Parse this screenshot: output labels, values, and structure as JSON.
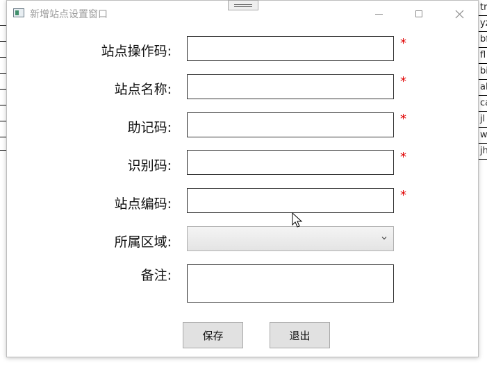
{
  "background_list": {
    "items": [
      "tr",
      "yz",
      "bf",
      "fl",
      "bi",
      "al",
      "ca",
      "jl",
      "w",
      "jh"
    ]
  },
  "window": {
    "title": "新增站点设置窗口",
    "controls": {
      "minimize": "minimize",
      "maximize": "maximize",
      "close": "close"
    }
  },
  "form": {
    "fields": [
      {
        "label": "站点操作码:",
        "value": "",
        "required": true,
        "marker": "*"
      },
      {
        "label": "站点名称:",
        "value": "",
        "required": true,
        "marker": "*"
      },
      {
        "label": "助记码:",
        "value": "",
        "required": true,
        "marker": "*"
      },
      {
        "label": "识别码:",
        "value": "",
        "required": true,
        "marker": "*"
      },
      {
        "label": "站点编码:",
        "value": "",
        "required": true,
        "marker": "*"
      }
    ],
    "region": {
      "label": "所属区域:",
      "value": ""
    },
    "notes": {
      "label": "备注:",
      "value": ""
    }
  },
  "buttons": {
    "save": "保存",
    "exit": "退出"
  },
  "colors": {
    "required_star": "#e00000",
    "button_bg": "#e1e1e1",
    "title_text": "#9a9a9a"
  }
}
